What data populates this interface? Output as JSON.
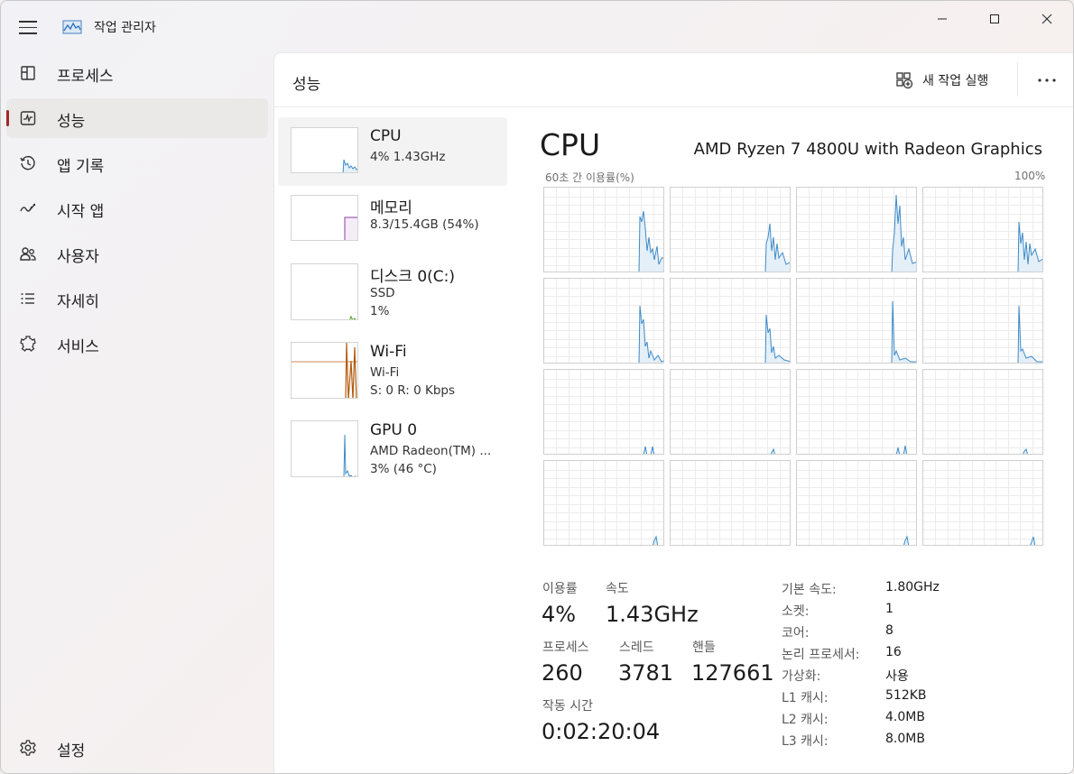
{
  "window": {
    "title": "작업 관리자"
  },
  "sidebar": {
    "items": [
      {
        "label": "프로세스",
        "icon": "processes-icon"
      },
      {
        "label": "성능",
        "icon": "performance-icon"
      },
      {
        "label": "앱 기록",
        "icon": "app-history-icon"
      },
      {
        "label": "시작 앱",
        "icon": "startup-apps-icon"
      },
      {
        "label": "사용자",
        "icon": "users-icon"
      },
      {
        "label": "자세히",
        "icon": "details-icon"
      },
      {
        "label": "서비스",
        "icon": "services-icon"
      }
    ],
    "active_index": 1,
    "settings_label": "설정"
  },
  "header": {
    "title": "성능",
    "new_task_label": "새 작업 실행"
  },
  "devices": [
    {
      "name": "CPU",
      "sub1": "4% 1.43GHz",
      "sub2": ""
    },
    {
      "name": "메모리",
      "sub1": "8.3/15.4GB (54%)",
      "sub2": ""
    },
    {
      "name": "디스크 0(C:)",
      "sub1": "SSD",
      "sub2": "1%"
    },
    {
      "name": "Wi-Fi",
      "sub1": "Wi-Fi",
      "sub2": "S: 0 R: 0 Kbps"
    },
    {
      "name": "GPU 0",
      "sub1": "AMD Radeon(TM) ...",
      "sub2": "3% (46 °C)"
    }
  ],
  "cpu": {
    "title": "CPU",
    "model": "AMD Ryzen 7 4800U with Radeon Graphics",
    "graph_label": "60초 간 이용률(%)",
    "graph_max": "100%"
  },
  "stats": {
    "utilization_label": "이용률",
    "utilization_value": "4%",
    "speed_label": "속도",
    "speed_value": "1.43GHz",
    "processes_label": "프로세스",
    "processes_value": "260",
    "threads_label": "스레드",
    "threads_value": "3781",
    "handles_label": "핸들",
    "handles_value": "127661",
    "uptime_label": "작동 시간",
    "uptime_value": "0:02:20:04"
  },
  "specs": [
    {
      "label": "기본 속도:",
      "value": "1.80GHz"
    },
    {
      "label": "소켓:",
      "value": "1"
    },
    {
      "label": "코어:",
      "value": "8"
    },
    {
      "label": "논리 프로세서:",
      "value": "16"
    },
    {
      "label": "가상화:",
      "value": "사용"
    },
    {
      "label": "L1 캐시:",
      "value": "512KB"
    },
    {
      "label": "L2 캐시:",
      "value": "4.0MB"
    },
    {
      "label": "L3 캐시:",
      "value": "8.0MB"
    }
  ],
  "colors": {
    "cpu_line": "#3e8bc8",
    "cpu_fill": "#e4eff8",
    "memory_line": "#8b3fa0",
    "disk_line": "#4f9a1f",
    "wifi_line": "#b35b0d",
    "gpu_line": "#3e8bc8",
    "accent_indicator": "#a0282a"
  }
}
